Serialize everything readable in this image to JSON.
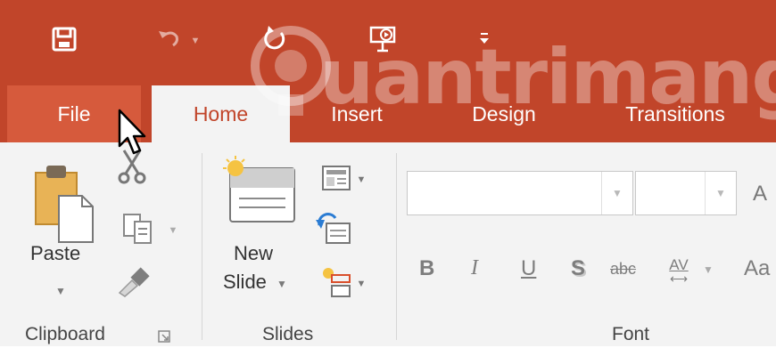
{
  "colors": {
    "accent": "#c1452a",
    "file_tab": "#d65a3c",
    "ribbon_bg": "#f3f3f3",
    "text": "#333333"
  },
  "quick_access": {
    "save_icon": "save-icon",
    "undo_icon": "undo-icon",
    "redo_icon": "redo-icon",
    "present_icon": "start-from-beginning-icon",
    "customize_icon": "customize-quick-access-icon"
  },
  "tabs": [
    {
      "label": "File"
    },
    {
      "label": "Home"
    },
    {
      "label": "Insert"
    },
    {
      "label": "Design"
    },
    {
      "label": "Transitions"
    }
  ],
  "ribbon": {
    "clipboard": {
      "paste_label": "Paste",
      "group_label": "Clipboard"
    },
    "slides": {
      "new_slide_line1": "New",
      "new_slide_line2": "Slide",
      "group_label": "Slides"
    },
    "font": {
      "bold": "B",
      "italic": "I",
      "underline": "U",
      "shadow": "S",
      "strikethrough": "abc",
      "spacing": "AV",
      "grow_font": "A",
      "change_case": "Aa",
      "group_label": "Font"
    }
  },
  "watermark": {
    "text": "uantrimang"
  }
}
